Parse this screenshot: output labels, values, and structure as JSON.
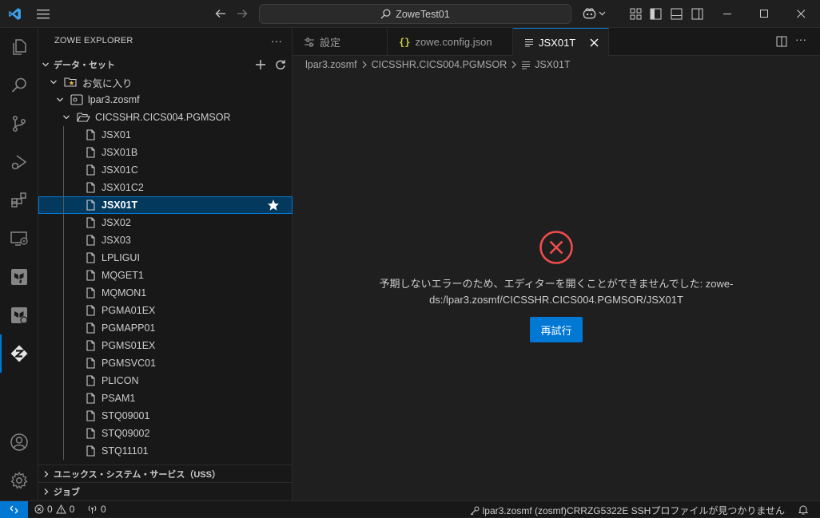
{
  "titlebar": {
    "search_text": "ZoweTest01"
  },
  "sidebar": {
    "title": "ZOWE EXPLORER",
    "more": "···",
    "datasets_section": "データ・セット",
    "favorites": "お気に入り",
    "profile": "lpar3.zosmf",
    "dataset": "CICSSHR.CICS004.PGMSOR",
    "members": [
      "JSX01",
      "JSX01B",
      "JSX01C",
      "JSX01C2",
      "JSX01T",
      "JSX02",
      "JSX03",
      "LPLIGUI",
      "MQGET1",
      "MQMON1",
      "PGMA01EX",
      "PGMAPP01",
      "PGMS01EX",
      "PGMSVC01",
      "PLICON",
      "PSAM1",
      "STQ09001",
      "STQ09002",
      "STQ11101"
    ],
    "selected_member": "JSX01T",
    "uss_section": "ユニックス・システム・サービス（USS）",
    "jobs_section": "ジョブ"
  },
  "tabs": [
    {
      "label": "設定",
      "icon": "settings-sliders-icon"
    },
    {
      "label": "zowe.config.json",
      "icon": "json-braces-icon"
    },
    {
      "label": "JSX01T",
      "icon": "file-lines-icon",
      "active": true
    }
  ],
  "breadcrumb": {
    "profile": "lpar3.zosmf",
    "dataset": "CICSSHR.CICS004.PGMSOR",
    "member": "JSX01T"
  },
  "editor": {
    "error_line1": "予期しないエラーのため、エディターを開くことができませんでした: zowe-",
    "error_line2": "ds:/lpar3.zosmf/CICSSHR.CICS004.PGMSOR/JSX01T",
    "retry_label": "再試行"
  },
  "statusbar": {
    "errors": "0",
    "warnings": "0",
    "ports": "0",
    "message": "lpar3.zosmf (zosmf)CRRZG5322E SSHプロファイルが見つかりません"
  },
  "colors": {
    "accent": "#0078d4",
    "error": "#f14c4c",
    "selection": "#04395e"
  }
}
